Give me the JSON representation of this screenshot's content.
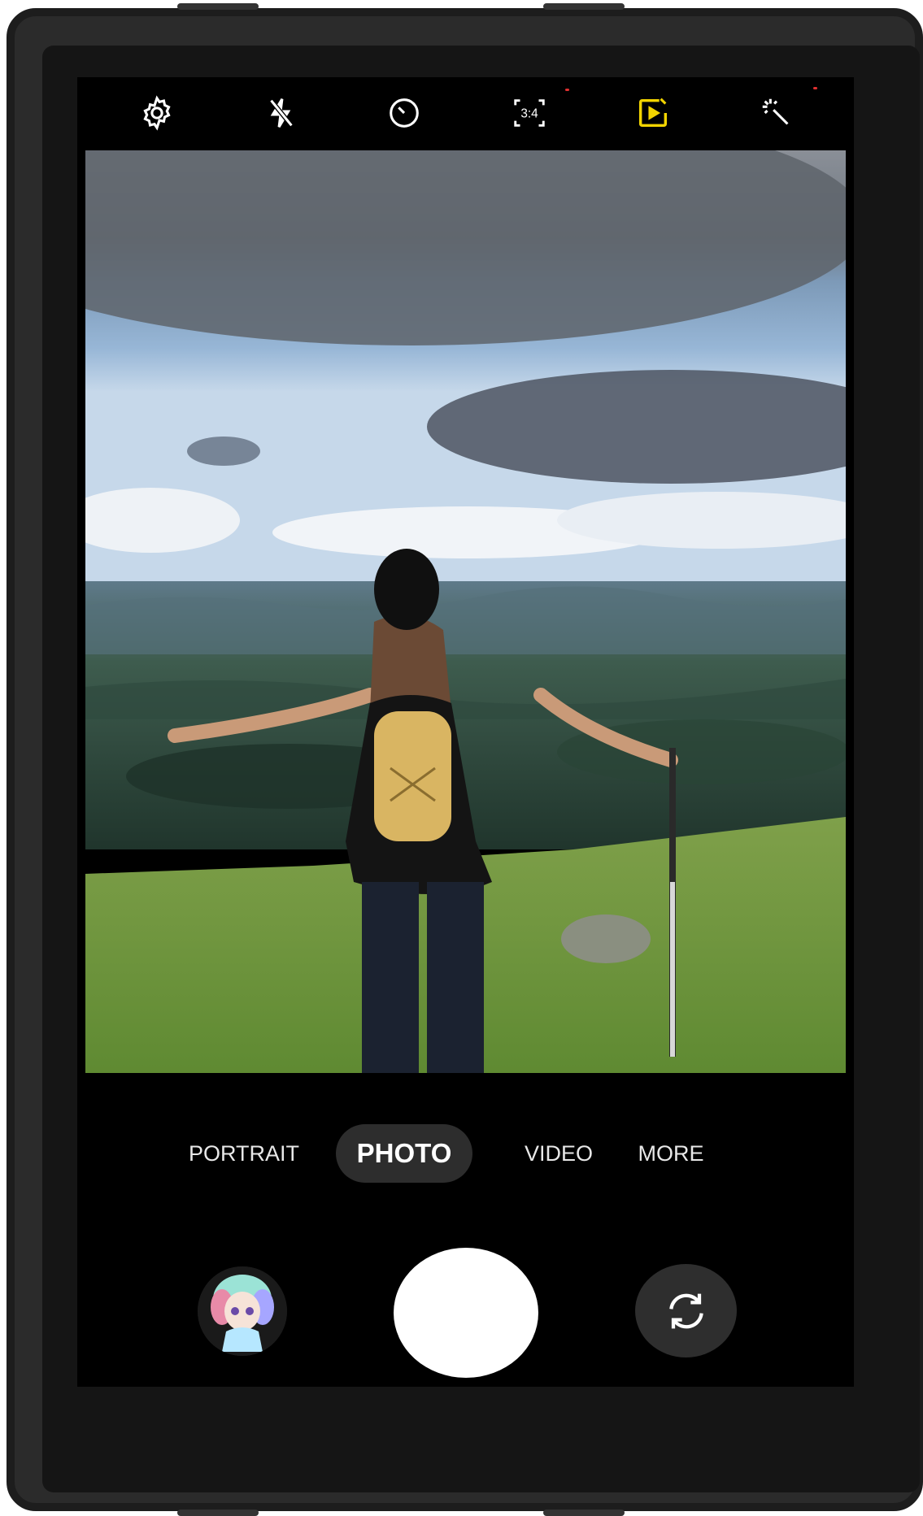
{
  "top_bar": {
    "icons": [
      "settings-icon",
      "flash-off-icon",
      "timer-icon",
      "aspect-ratio-icon",
      "motion-photo-icon",
      "filters-icon"
    ],
    "aspect_ratio_label": "3:4",
    "accent_color": "#f2d400"
  },
  "viewfinder": {
    "content": "photo-preview"
  },
  "modes": {
    "items": [
      {
        "label": "PORTRAIT"
      },
      {
        "label": "PHOTO"
      },
      {
        "label": "VIDEO"
      },
      {
        "label": "MORE"
      }
    ],
    "selected": "PHOTO"
  },
  "controls": {
    "gallery_icon": "gallery-thumbnail",
    "shutter_icon": "shutter-button",
    "switch_camera_icon": "switch-camera-icon"
  }
}
